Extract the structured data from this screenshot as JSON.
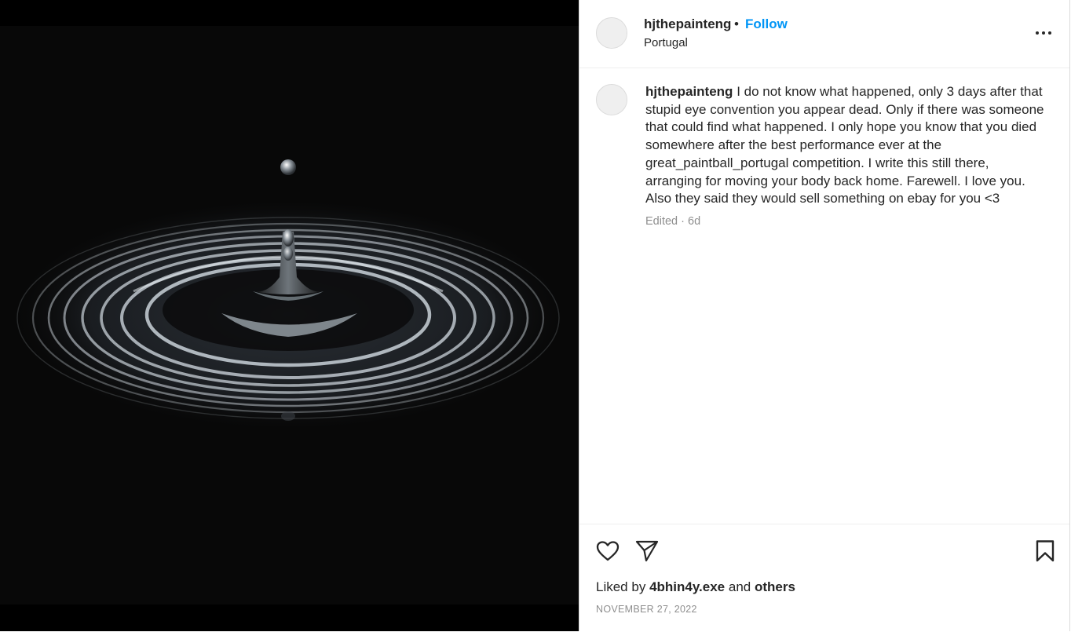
{
  "post": {
    "image": {
      "name": "water-drop-ripple-photo"
    },
    "author": {
      "username": "hjthepainteng",
      "location": "Portugal",
      "follow_label": "Follow",
      "separator": "•"
    },
    "caption": {
      "username": "hjthepainteng",
      "text": "I do not know what happened, only 3 days after that stupid eye convention you appear dead. Only if there was someone that could find what happened. I only hope you know that you died somewhere after the best performance ever at the great_paintball_portugal competition. I write this still there, arranging for moving your body back home. Farewell. I love you. Also they said they would sell something on ebay for you <3",
      "meta": "Edited · 6d"
    },
    "actions": {
      "icons": [
        "heart-icon",
        "share-icon",
        "bookmark-icon"
      ]
    },
    "likes": {
      "prefix": "Liked by",
      "user": "4bhin4y.exe",
      "conj": "and",
      "others": "others"
    },
    "date": "NOVEMBER 27, 2022"
  },
  "colors": {
    "accent": "#0095f6",
    "text": "#262626",
    "muted": "#8e8e8e"
  }
}
